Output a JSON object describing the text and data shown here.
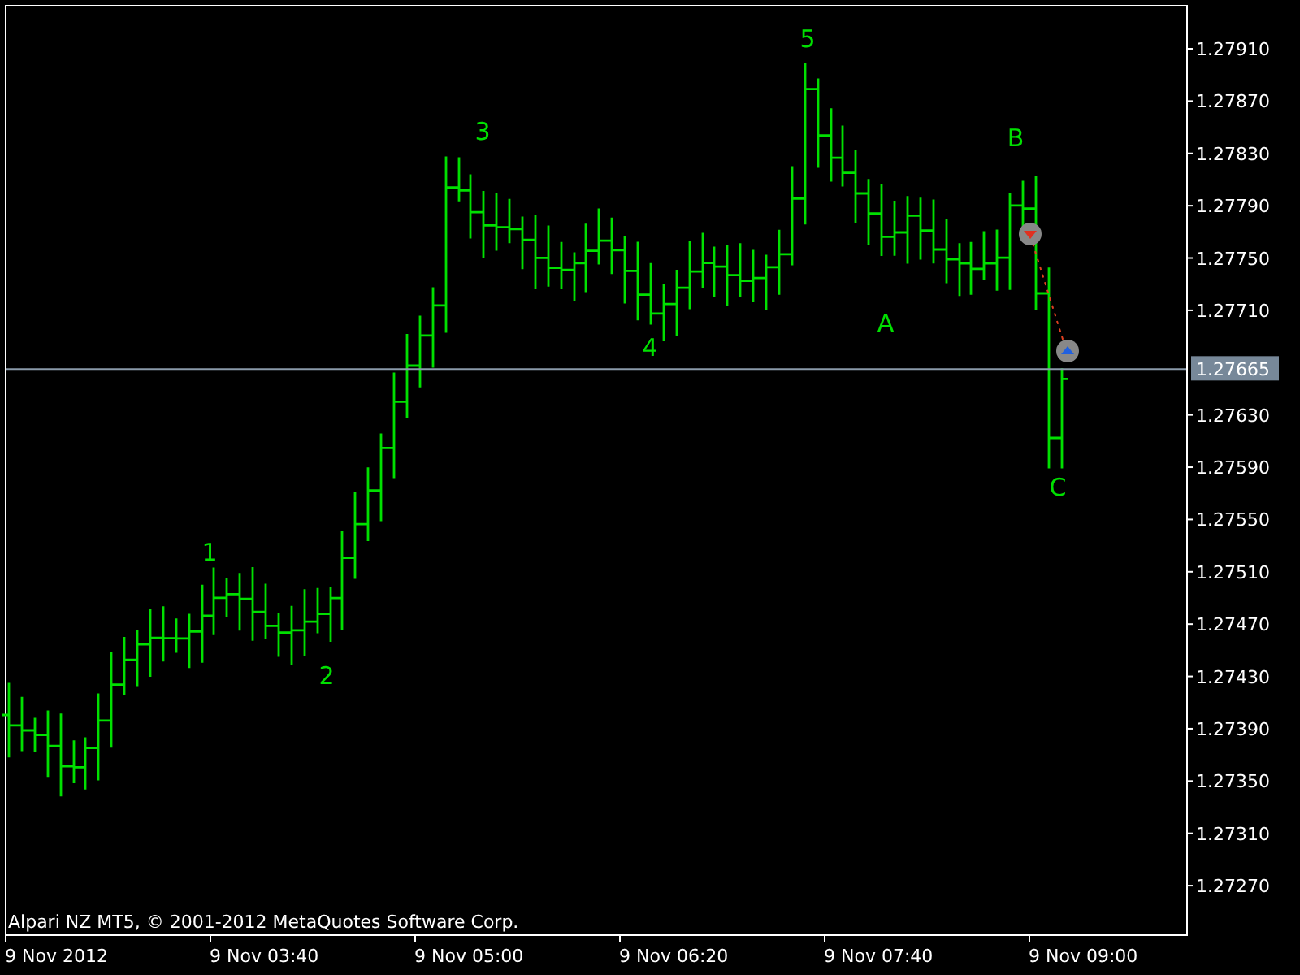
{
  "chart": {
    "price_labels": [
      "1.27910",
      "1.27870",
      "1.27830",
      "1.27790",
      "1.27750",
      "1.27710",
      "1.27630",
      "1.27590",
      "1.27550",
      "1.27510",
      "1.27470",
      "1.27430",
      "1.27390",
      "1.27350",
      "1.27310",
      "1.27270"
    ],
    "current_price": "1.27665",
    "time_labels": [
      "9 Nov 2012",
      "9 Nov 03:40",
      "9 Nov 05:00",
      "9 Nov 06:20",
      "9 Nov 07:40",
      "9 Nov 09:00"
    ],
    "wave_labels": [
      "1",
      "2",
      "3",
      "4",
      "5",
      "A",
      "B",
      "C"
    ],
    "copyright": "Alpari NZ MT5, © 2001-2012 MetaQuotes Software Corp."
  }
}
